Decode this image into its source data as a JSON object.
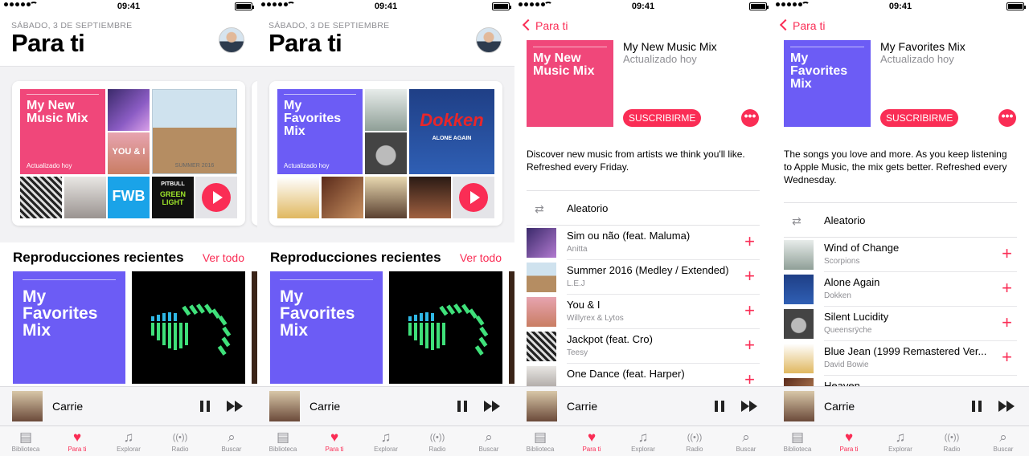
{
  "status": {
    "time": "09:41"
  },
  "tabs": [
    {
      "label": "Biblioteca",
      "icon": "library-icon",
      "glyph": "▤"
    },
    {
      "label": "Para ti",
      "icon": "heart-icon",
      "glyph": "♥"
    },
    {
      "label": "Explorar",
      "icon": "music-note-icon",
      "glyph": "♫"
    },
    {
      "label": "Radio",
      "icon": "radio-icon",
      "glyph": "((•))"
    },
    {
      "label": "Buscar",
      "icon": "search-icon",
      "glyph": "⌕"
    }
  ],
  "mini_player": {
    "song": "Carrie"
  },
  "for_you": {
    "date": "SÁBADO, 3 DE SEPTIEMBRE",
    "title": "Para ti",
    "mix1": {
      "name": "My New Music Mix",
      "updated": "Actualizado hoy",
      "color": "#f0477a"
    },
    "mix2": {
      "name": "My Favorites Mix",
      "updated": "Actualizado hoy",
      "color": "#6c5cf5"
    },
    "album_texts": {
      "summer": "SUMMER 2016",
      "fwb": "FWB",
      "pitbull": "PITBULL",
      "greenlight": "GREEN LIGHT",
      "dokken": "Dokken",
      "alone": "ALONE AGAIN"
    },
    "recent": {
      "title": "Reproducciones recientes",
      "see_all": "Ver todo",
      "mix_name": "My Favorites Mix"
    }
  },
  "detail_new": {
    "back": "Para ti",
    "title": "My New Music Mix",
    "updated": "Actualizado hoy",
    "subscribe": "SUSCRIBIRME",
    "more": "•••",
    "description": "Discover new music from artists we think you'll like. Refreshed every Friday.",
    "shuffle": "Aleatorio",
    "tracks": [
      {
        "title": "Sim ou não (feat. Maluma)",
        "artist": "Anitta"
      },
      {
        "title": "Summer 2016 (Medley / Extended)",
        "artist": "L.E.J"
      },
      {
        "title": "You & I",
        "artist": "Willyrex & Lytos"
      },
      {
        "title": "Jackpot (feat. Cro)",
        "artist": "Teesy"
      },
      {
        "title": "One Dance (feat. Harper)",
        "artist": ""
      }
    ]
  },
  "detail_fav": {
    "back": "Para ti",
    "title": "My Favorites Mix",
    "updated": "Actualizado hoy",
    "subscribe": "SUSCRIBIRME",
    "more": "•••",
    "description": "The songs you love and more. As you keep listening to Apple Music, the mix gets better. Refreshed every Wednesday.",
    "shuffle": "Aleatorio",
    "tracks": [
      {
        "title": "Wind of Change",
        "artist": "Scorpions"
      },
      {
        "title": "Alone Again",
        "artist": "Dokken"
      },
      {
        "title": "Silent Lucidity",
        "artist": "Queensrÿche"
      },
      {
        "title": "Blue Jean (1999 Remastered Ver...",
        "artist": "David Bowie"
      },
      {
        "title": "Heaven",
        "artist": ""
      }
    ]
  }
}
